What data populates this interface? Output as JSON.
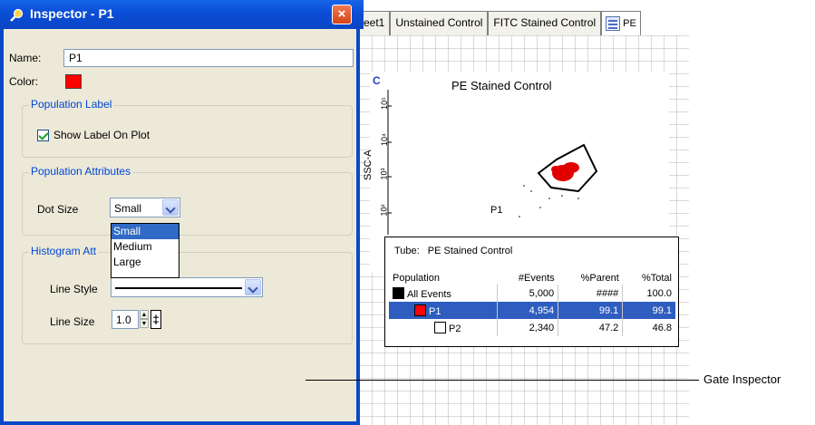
{
  "inspector": {
    "title": "Inspector - P1",
    "close_label": "×",
    "name_label": "Name:",
    "name_value": "P1",
    "color_label": "Color:",
    "color_value": "#ff0000",
    "population_label_group": "Population Label",
    "show_label_checkbox": "Show Label On Plot",
    "show_label_checked": true,
    "population_attributes_group": "Population Attributes",
    "dot_size_label": "Dot Size",
    "dot_size_value": "Small",
    "dot_size_options": [
      "Small",
      "Medium",
      "Large"
    ],
    "histogram_group": "Histogram Att",
    "line_style_label": "Line Style",
    "line_size_label": "Line Size",
    "line_size_value": "1.0"
  },
  "tabs": {
    "items": [
      "eet1",
      "Unstained Control",
      "FITC Stained Control",
      "PE"
    ]
  },
  "plot": {
    "letter": "C",
    "title": "PE Stained Control",
    "ylabel": "SSC-A",
    "yticks": [
      "10⁵",
      "10⁴",
      "10³",
      "10²"
    ],
    "gate_label": "P1"
  },
  "stats": {
    "tube_label": "Tube:",
    "tube_name": "PE Stained Control",
    "headers": [
      "Population",
      "#Events",
      "%Parent",
      "%Total"
    ],
    "rows": [
      {
        "name": "All Events",
        "events": "5,000",
        "parent": "####",
        "total": "100.0",
        "color": "#000000"
      },
      {
        "name": "P1",
        "events": "4,954",
        "parent": "99.1",
        "total": "99.1",
        "color": "#ff0000"
      },
      {
        "name": "P2",
        "events": "2,340",
        "parent": "47.2",
        "total": "46.8",
        "color": "#ffffff"
      }
    ]
  },
  "callout": "Gate Inspector",
  "colors": {
    "title_bar": "#0b4fd8",
    "selection": "#2f5dbf",
    "group_title": "#0046d5"
  }
}
